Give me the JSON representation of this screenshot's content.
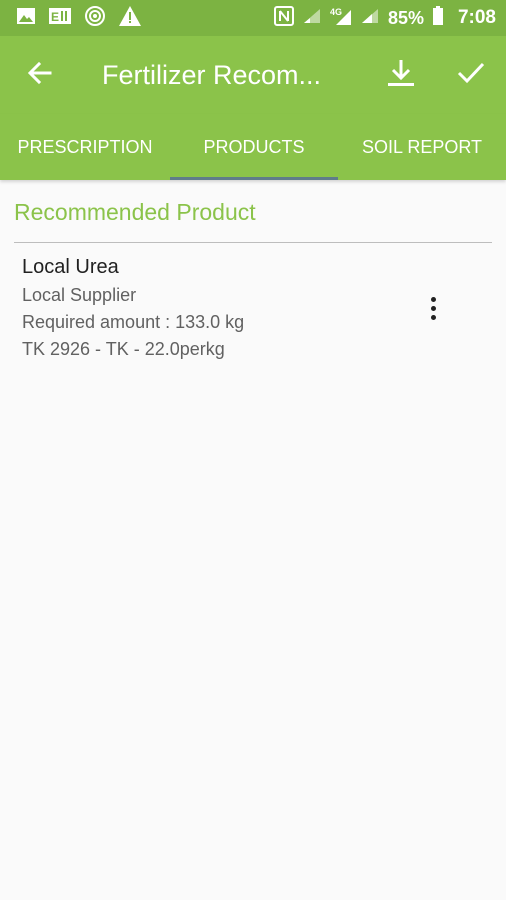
{
  "status_bar": {
    "battery": "85%",
    "time": "7:08"
  },
  "toolbar": {
    "title": "Fertilizer Recom..."
  },
  "tabs": [
    {
      "label": "PRESCRIPTION",
      "active": false
    },
    {
      "label": "PRODUCTS",
      "active": true
    },
    {
      "label": "SOIL REPORT",
      "active": false
    }
  ],
  "section": {
    "title": "Recommended Product"
  },
  "products": [
    {
      "name": "Local Urea",
      "supplier": "Local Supplier",
      "required": "Required amount : 133.0 kg",
      "price": "TK 2926 - TK - 22.0perkg"
    }
  ],
  "colors": {
    "primary": "#8bc34a",
    "status_bar": "#7cb342",
    "tab_indicator": "#5f7c8a",
    "background": "#fafafa"
  }
}
